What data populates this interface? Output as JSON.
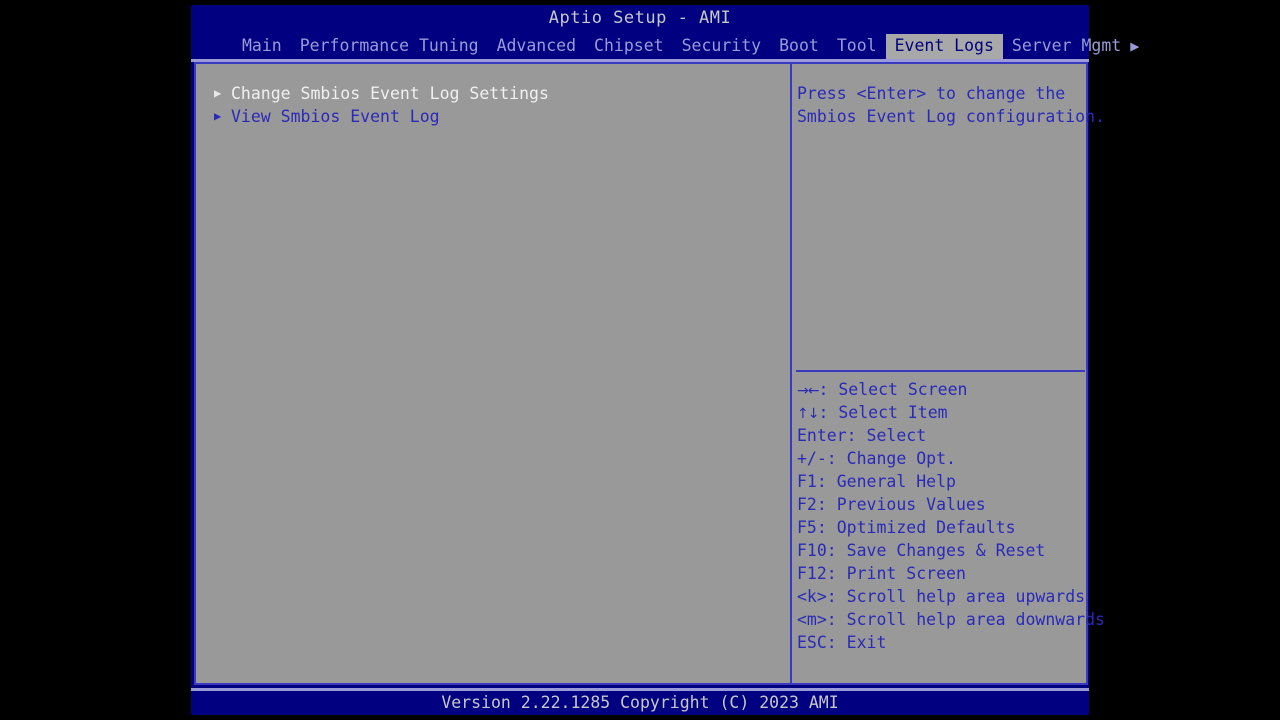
{
  "window": {
    "title": "Aptio Setup - AMI",
    "footer": "Version 2.22.1285 Copyright (C) 2023 AMI",
    "scroll_right_indicator": "▶"
  },
  "colors": {
    "background": "#000000",
    "panel_bg": "#999999",
    "title_bg": "#000080",
    "accent_blue": "#2a2ab8",
    "border_blue": "#3a3ac0",
    "menu_text": "#9a9ad8",
    "active_tab_bg": "#a8a8a8",
    "active_tab_text": "#000080",
    "selected_text": "#f0f0f0",
    "title_text": "#c8c8c8"
  },
  "menu": {
    "tabs": [
      {
        "label": "Main",
        "active": false
      },
      {
        "label": "Performance Tuning",
        "active": false
      },
      {
        "label": "Advanced",
        "active": false
      },
      {
        "label": "Chipset",
        "active": false
      },
      {
        "label": "Security",
        "active": false
      },
      {
        "label": "Boot",
        "active": false
      },
      {
        "label": "Tool",
        "active": false
      },
      {
        "label": "Event Logs",
        "active": true
      },
      {
        "label": "Server Mgmt",
        "active": false
      }
    ]
  },
  "main": {
    "items": [
      {
        "label": "Change Smbios Event Log Settings",
        "arrow": "▶",
        "selected": true
      },
      {
        "label": "View Smbios Event Log",
        "arrow": "▶",
        "selected": false
      }
    ]
  },
  "help": {
    "description": "Press <Enter> to change the\nSmbios Event Log configuration.",
    "hotkeys": [
      {
        "glyph": "→←",
        "text": ": Select Screen"
      },
      {
        "glyph": "↑↓",
        "text": ": Select Item"
      },
      {
        "glyph": "",
        "text": "Enter: Select"
      },
      {
        "glyph": "",
        "text": "+/-: Change Opt."
      },
      {
        "glyph": "",
        "text": "F1: General Help"
      },
      {
        "glyph": "",
        "text": "F2: Previous Values"
      },
      {
        "glyph": "",
        "text": "F5: Optimized Defaults"
      },
      {
        "glyph": "",
        "text": "F10: Save Changes & Reset"
      },
      {
        "glyph": "",
        "text": "F12: Print Screen"
      },
      {
        "glyph": "",
        "text": "<k>: Scroll help area upwards"
      },
      {
        "glyph": "",
        "text": "<m>: Scroll help area downwards"
      },
      {
        "glyph": "",
        "text": "ESC: Exit"
      }
    ]
  }
}
